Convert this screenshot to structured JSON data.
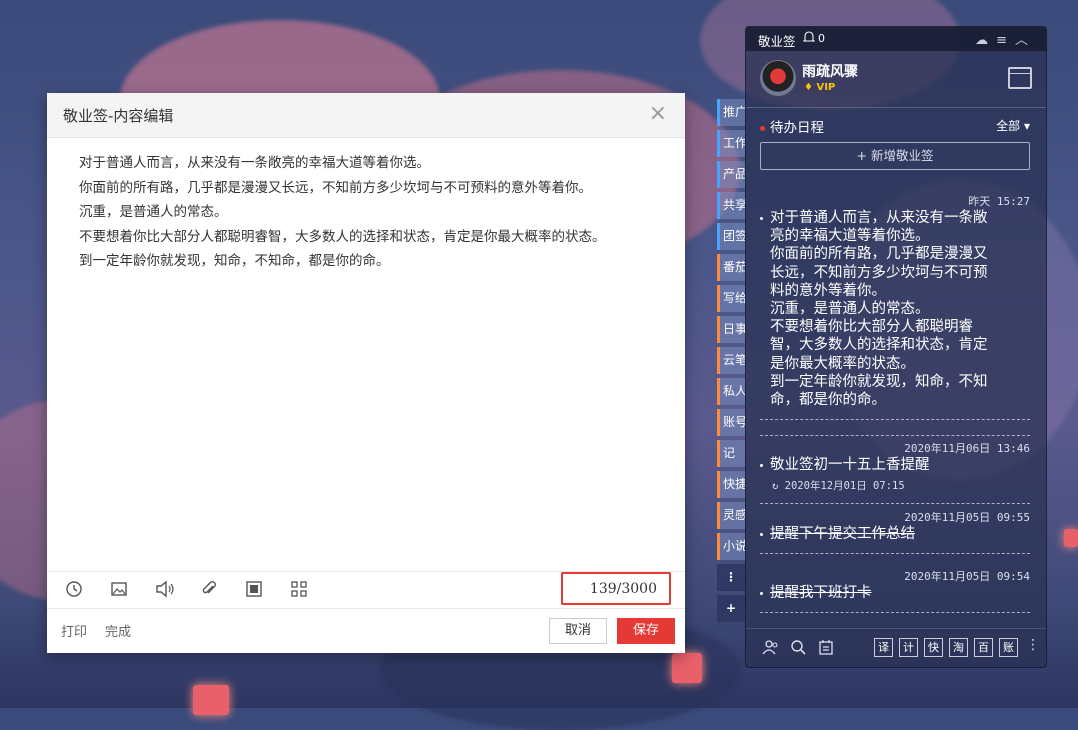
{
  "editor": {
    "title": "敬业签-内容编辑",
    "close": "×",
    "lines": [
      "对于普通人而言，从来没有一条敞亮的幸福大道等着你选。",
      "你面前的所有路，几乎都是漫漫又长远，不知前方多少坎坷与不可预料的意外等着你。",
      "沉重，是普通人的常态。",
      "不要想着你比大部分人都聪明睿智，大多数人的选择和状态，肯定是你最大概率的状态。",
      "到一定年龄你就发现，知命，不知命，都是你的命。"
    ],
    "toolbar_icons": [
      "clock-icon",
      "image-icon",
      "audio-icon",
      "attachment-icon",
      "stop-icon",
      "qr-code-icon"
    ],
    "counter": "139/3000",
    "print": "打印",
    "done": "完成",
    "cancel": "取消",
    "save": "保存"
  },
  "sidetabs": [
    "推广",
    "工作",
    "产品",
    "共享",
    "团签",
    "番茄",
    "写给",
    "日事",
    "云笔",
    "私人",
    "账号",
    "记",
    "快捷",
    "灵感",
    "小说",
    "⋮",
    "+"
  ],
  "panel": {
    "title": "敬业签",
    "bell_count": "0",
    "user_name": "雨疏风骤",
    "vip": "VIP",
    "todo_title": "待办日程",
    "filter": "全部",
    "add_note": "+ 新增敬业签",
    "notes": [
      {
        "time": "昨天  15:27",
        "lines": [
          "对于普通人而言，从来没有一条敞",
          "亮的幸福大道等着你选。",
          "你面前的所有路，几乎都是漫漫又",
          "长远，不知前方多少坎坷与不可预",
          "料的意外等着你。",
          "沉重，是普通人的常态。",
          "不要想着你比大部分人都聪明睿",
          "智，大多数人的选择和状态，肯定",
          "是你最大概率的状态。",
          "到一定年龄你就发现，知命，不知",
          "命，都是你的命。"
        ],
        "done": false
      },
      {
        "time": "2020年11月06日  13:46",
        "lines": [
          "敬业签初一十五上香提醒"
        ],
        "sub": "2020年12月01日  07:15",
        "done": false
      },
      {
        "time": "2020年11月05日  09:55",
        "lines": [
          "提醒下午提交工作总结"
        ],
        "done": true
      },
      {
        "time": "2020年11月05日  09:54",
        "lines": [
          "提醒我下班打卡"
        ],
        "done": true
      }
    ],
    "bottom_square_buttons": [
      "译",
      "计",
      "快",
      "淘",
      "百",
      "账"
    ]
  }
}
